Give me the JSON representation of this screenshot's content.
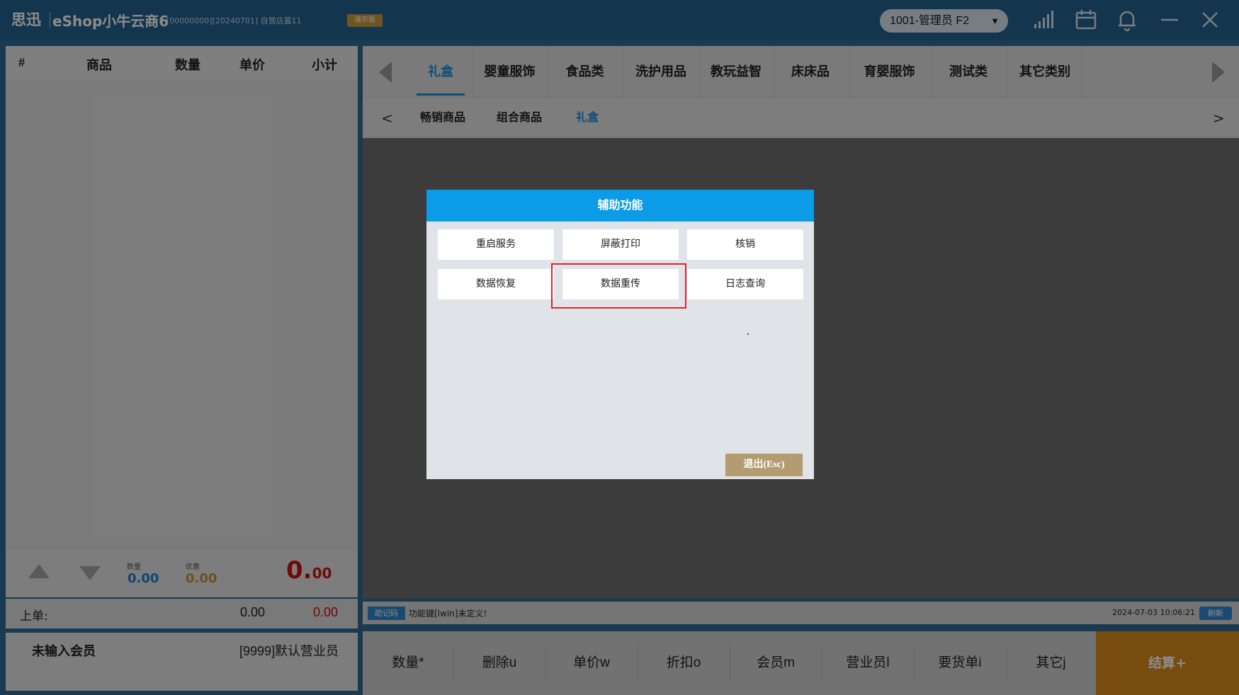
{
  "titlebar": {
    "brand": "思迅",
    "app_name": "eShop小牛云商6",
    "meta": "[00000000][20240701]  自营店蓋11",
    "demo_badge": "演示版",
    "user": "1001-管理员 F2",
    "user_caret": "▼",
    "icons": [
      "signal-icon",
      "calendar-icon",
      "bell-icon",
      "minimize-icon",
      "close-icon"
    ]
  },
  "cart": {
    "columns": [
      "#",
      "商品",
      "数量",
      "单价",
      "小计"
    ],
    "rows": [],
    "qty_label": "数量",
    "qty_value": "0.00",
    "discount_label": "优惠",
    "discount_value": "0.00",
    "total_int": "0.",
    "total_dec": "00"
  },
  "prev_order": {
    "label": "上单:",
    "qty": "0.00",
    "amount": "0.00"
  },
  "member": {
    "status": "未输入会员",
    "salesperson": "[9999]默认营业员"
  },
  "tabs": {
    "items": [
      "礼盒",
      "婴童服饰",
      "食品类",
      "洗护用品",
      "教玩益智",
      "床床品",
      "育婴服饰",
      "测试类",
      "其它类别"
    ],
    "active_index": 0
  },
  "subtabs": {
    "left_arrow": "<",
    "right_arrow": ">",
    "items": [
      "畅销商品",
      "组合商品",
      "礼盒"
    ],
    "active_index": 2
  },
  "statusbar": {
    "hint_badge": "助记码",
    "hint_text": "功能键[lwin]未定义!",
    "datetime": "2024-07-03 10:06:21",
    "refresh": "刷新"
  },
  "actions": {
    "items": [
      "数量*",
      "删除u",
      "单价w",
      "折扣o",
      "会员m",
      "营业员l",
      "要货单i",
      "其它j"
    ],
    "checkout": "结算+"
  },
  "dialog": {
    "title": "辅助功能",
    "buttons": [
      "重启服务",
      "屏蔽打印",
      "核销",
      "数据恢复",
      "数据重传",
      "日志查询"
    ],
    "exit": "退出(Esc)"
  },
  "colors": {
    "titlebar": "#24618c",
    "accent": "#1a8fdc",
    "dialog_header": "#0c9be6",
    "checkout": "#d98a1b",
    "total_red": "#cc1111",
    "highlight_border": "#e0242b"
  }
}
